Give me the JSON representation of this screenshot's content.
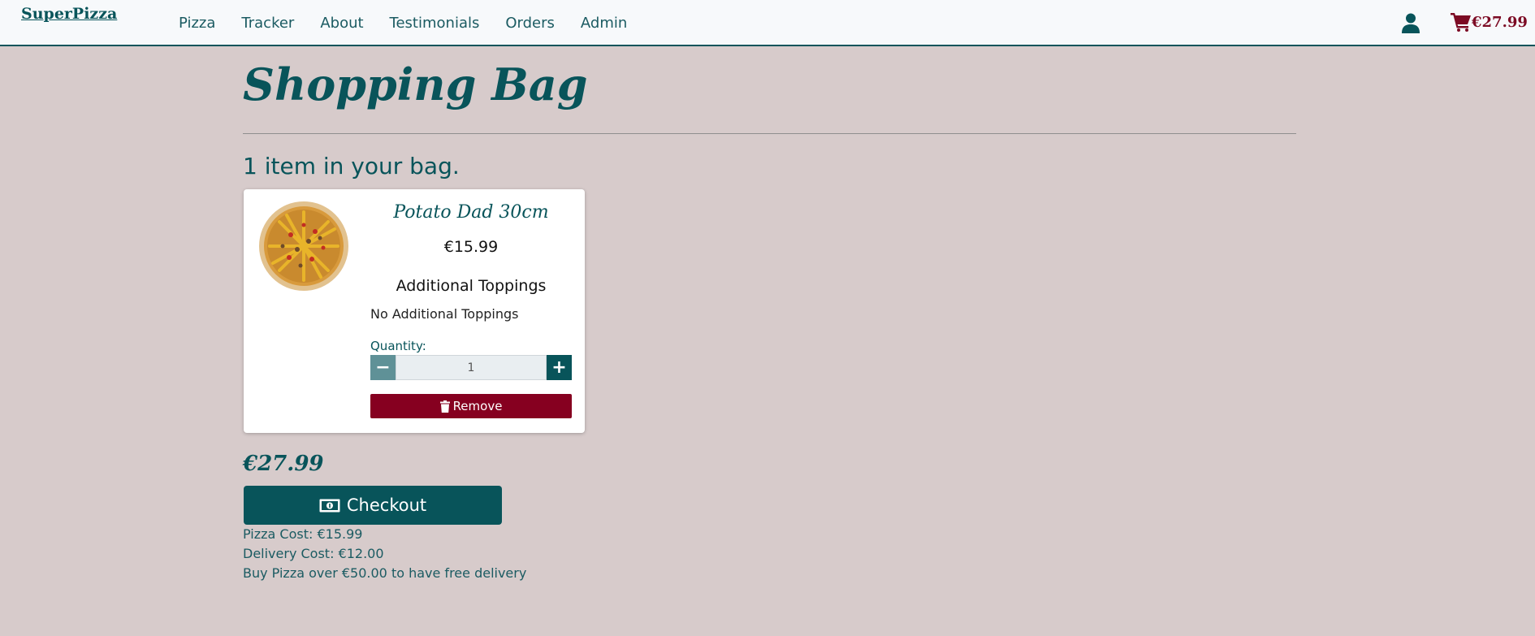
{
  "nav": {
    "brand": "SuperPizza",
    "links": [
      "Pizza",
      "Tracker",
      "About",
      "Testimonials",
      "Orders",
      "Admin"
    ],
    "user_icon": "user-icon",
    "cart_icon": "shopping-cart-icon",
    "cart_total": "€27.99"
  },
  "page": {
    "title": "Shopping Bag",
    "item_count": "1 item in your bag."
  },
  "item": {
    "image_icon": "pizza-image",
    "name": "Potato Dad 30cm",
    "price": "€15.99",
    "toppings_title": "Additional Toppings",
    "toppings_text": "No Additional Toppings",
    "quantity_label": "Quantity:",
    "quantity_value": "1",
    "minus_label": "−",
    "plus_label": "+",
    "remove_label": "Remove",
    "remove_icon": "trash-icon"
  },
  "summary": {
    "total": "€27.99",
    "checkout_label": "Checkout",
    "checkout_icon": "money-bill-icon",
    "pizza_cost": "Pizza Cost: €15.99",
    "delivery_cost": "Delivery Cost: €12.00",
    "free_delivery_note": "Buy Pizza over €50.00 to have free delivery"
  },
  "colors": {
    "primary": "#08545a",
    "danger": "#860020",
    "background": "#d7cbcb",
    "cart_total": "#7c0b24"
  }
}
